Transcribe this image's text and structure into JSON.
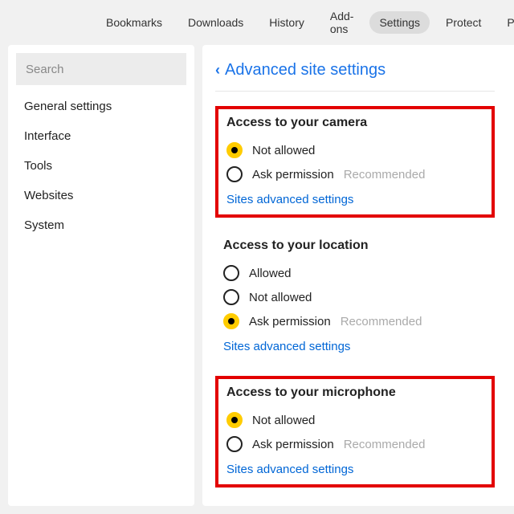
{
  "topbar": {
    "items": [
      {
        "label": "Bookmarks"
      },
      {
        "label": "Downloads"
      },
      {
        "label": "History"
      },
      {
        "label": "Add-ons"
      },
      {
        "label": "Settings"
      },
      {
        "label": "Protect"
      },
      {
        "label": "Passwords"
      }
    ],
    "active_index": 4
  },
  "sidebar": {
    "search_placeholder": "Search",
    "items": [
      {
        "label": "General settings"
      },
      {
        "label": "Interface"
      },
      {
        "label": "Tools"
      },
      {
        "label": "Websites"
      },
      {
        "label": "System"
      }
    ]
  },
  "main": {
    "breadcrumb": "Advanced site settings",
    "recommended_label": "Recommended",
    "advanced_link_label": "Sites advanced settings",
    "groups": [
      {
        "title": "Access to your camera",
        "highlighted": true,
        "options": [
          {
            "label": "Not allowed",
            "selected": true,
            "recommended": false
          },
          {
            "label": "Ask permission",
            "selected": false,
            "recommended": true
          }
        ]
      },
      {
        "title": "Access to your location",
        "highlighted": false,
        "options": [
          {
            "label": "Allowed",
            "selected": false,
            "recommended": false
          },
          {
            "label": "Not allowed",
            "selected": false,
            "recommended": false
          },
          {
            "label": "Ask permission",
            "selected": true,
            "recommended": true
          }
        ]
      },
      {
        "title": "Access to your microphone",
        "highlighted": true,
        "options": [
          {
            "label": "Not allowed",
            "selected": true,
            "recommended": false
          },
          {
            "label": "Ask permission",
            "selected": false,
            "recommended": true
          }
        ]
      }
    ]
  }
}
